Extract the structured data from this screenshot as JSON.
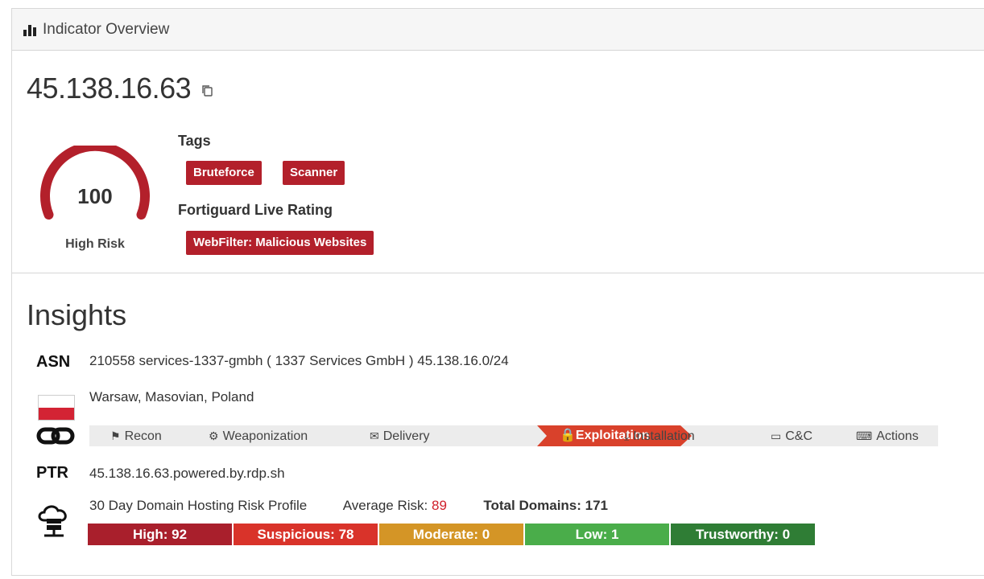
{
  "header": {
    "title": "Indicator Overview",
    "icon": "bar-chart-icon"
  },
  "indicator": {
    "ip": "45.138.16.63",
    "copy_icon": "copy-icon"
  },
  "risk": {
    "score": "100",
    "label": "High Risk",
    "score_fraction": 1.0,
    "color": "#b3202b"
  },
  "tags": {
    "label": "Tags",
    "items": [
      "Bruteforce",
      "Scanner"
    ]
  },
  "fortiguard": {
    "label": "Fortiguard Live Rating",
    "rating": "WebFilter: Malicious Websites"
  },
  "insights": {
    "title": "Insights",
    "asn": {
      "key": "ASN",
      "value": "210558 services-1337-gmbh ( 1337 Services GmbH ) 45.138.16.0/24"
    },
    "location": {
      "flag": "poland-flag",
      "value": "Warsaw, Masovian, Poland"
    },
    "kill_chain": {
      "icon": "link-icon",
      "active": "Exploitation",
      "steps": [
        {
          "label": "Recon",
          "icon": "binoculars-icon"
        },
        {
          "label": "Weaponization",
          "icon": "gear-icon"
        },
        {
          "label": "Delivery",
          "icon": "envelope-icon"
        },
        {
          "label": "Exploitation",
          "icon": "lock-icon"
        },
        {
          "label": "Installation",
          "icon": "download-icon"
        },
        {
          "label": "C&C",
          "icon": "laptop-icon"
        },
        {
          "label": "Actions",
          "icon": "keyboard-icon"
        }
      ]
    },
    "ptr": {
      "key": "PTR",
      "value": "45.138.16.63.powered.by.rdp.sh"
    },
    "hosting": {
      "icon": "cloud-server-icon",
      "title": "30 Day Domain Hosting Risk Profile",
      "average_risk_label": "Average Risk:",
      "average_risk_value": "89",
      "total_domains_label": "Total Domains: 171",
      "segments": [
        {
          "label": "High: 92",
          "color": "#a91f2c"
        },
        {
          "label": "Suspicious: 78",
          "color": "#d9332a"
        },
        {
          "label": "Moderate: 0",
          "color": "#d49526"
        },
        {
          "label": "Low: 1",
          "color": "#4aad4a"
        },
        {
          "label": "Trustworthy: 0",
          "color": "#2f7d35"
        }
      ]
    }
  }
}
